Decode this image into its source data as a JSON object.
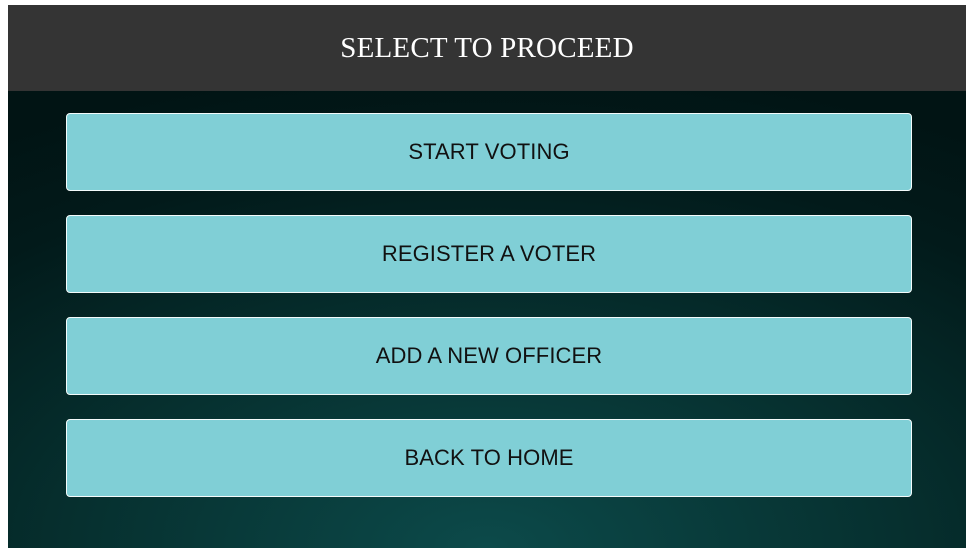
{
  "header": {
    "title": "SELECT TO PROCEED"
  },
  "menu": {
    "buttons": [
      {
        "label": "START VOTING"
      },
      {
        "label": "REGISTER A VOTER"
      },
      {
        "label": "ADD A NEW OFFICER"
      },
      {
        "label": "BACK TO HOME"
      }
    ]
  },
  "colors": {
    "header_background": "#343434",
    "button_background": "#80cfd6",
    "page_background": "#021a1a"
  }
}
